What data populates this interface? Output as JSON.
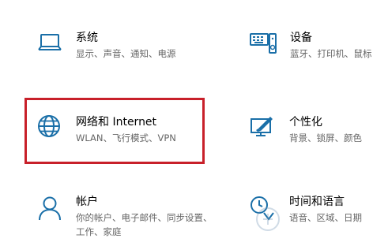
{
  "tiles": [
    {
      "id": "system",
      "title": "系统",
      "desc": "显示、声音、通知、电源",
      "icon": "laptop-icon"
    },
    {
      "id": "devices",
      "title": "设备",
      "desc": "蓝牙、打印机、鼠标",
      "icon": "keyboard-speaker-icon"
    },
    {
      "id": "network",
      "title": "网络和 Internet",
      "desc": "WLAN、飞行模式、VPN",
      "icon": "globe-icon"
    },
    {
      "id": "personalization",
      "title": "个性化",
      "desc": "背景、锁屏、颜色",
      "icon": "paint-monitor-icon"
    },
    {
      "id": "accounts",
      "title": "帐户",
      "desc_line1": "你的帐户、电子邮件、同步设置、",
      "desc_line2": "工作、家庭",
      "icon": "person-icon"
    },
    {
      "id": "time-language",
      "title": "时间和语言",
      "desc_line1": "语音、区域、日期",
      "icon": "clock-language-icon"
    }
  ],
  "colors": {
    "icon": "#1a6fa8",
    "highlight": "#c8202a",
    "desc": "#666666"
  }
}
